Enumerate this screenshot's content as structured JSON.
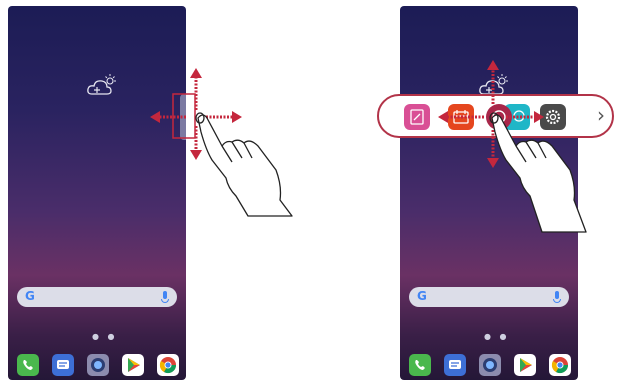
{
  "screens": [
    {
      "id": "left",
      "search": {
        "logo": "G"
      },
      "dock": [
        "phone-icon",
        "messages-icon",
        "camera-icon",
        "play-store-icon",
        "chrome-icon"
      ]
    },
    {
      "id": "right",
      "search": {
        "logo": "G"
      },
      "dock": [
        "phone-icon",
        "messages-icon",
        "camera-icon",
        "play-store-icon",
        "chrome-icon"
      ],
      "quick_bar": {
        "apps": [
          "memo-icon",
          "calendar-icon",
          "q-floating-icon",
          "find-icon",
          "settings-icon"
        ],
        "next_glyph": "›"
      }
    }
  ],
  "colors": {
    "arrow": "#c4273d",
    "bar_border": "#b23348"
  }
}
